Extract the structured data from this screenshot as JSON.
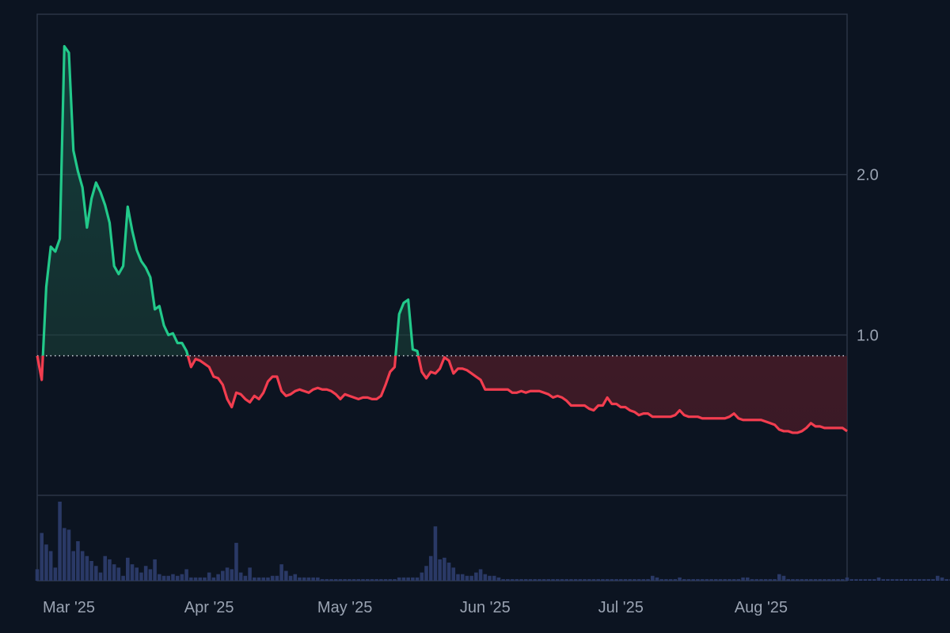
{
  "chart_data": {
    "type": "area",
    "title": "",
    "xlabel": "",
    "ylabel": "",
    "baseline": 0.87,
    "xlim": [
      "2025-02-22",
      "2025-08-20"
    ],
    "ylim": [
      0.0,
      3.0
    ],
    "y_ticks": [
      1.0,
      2.0
    ],
    "y_tick_labels": [
      "1.0",
      "2.0"
    ],
    "x_ticks": [
      "2025-03-01",
      "2025-04-01",
      "2025-05-01",
      "2025-06-01",
      "2025-07-01",
      "2025-08-01"
    ],
    "x_tick_labels": [
      "Mar '25",
      "Apr '25",
      "May '25",
      "Jun '25",
      "Jul '25",
      "Aug '25"
    ],
    "grid": true,
    "legend": "none",
    "colors": {
      "background": "#0c1421",
      "above_baseline": "#22c98a",
      "below_baseline": "#f23d4f",
      "volume": "#2a3966",
      "grid": "#2b3546",
      "baseline": "#d0d6e0"
    },
    "series": [
      {
        "x": [
          "2025-02-22",
          "2025-02-23",
          "2025-02-24",
          "2025-02-25",
          "2025-02-26",
          "2025-02-27",
          "2025-02-28",
          "2025-03-01",
          "2025-03-02",
          "2025-03-03",
          "2025-03-04",
          "2025-03-05",
          "2025-03-06",
          "2025-03-07",
          "2025-03-08",
          "2025-03-09",
          "2025-03-10",
          "2025-03-11",
          "2025-03-12",
          "2025-03-13",
          "2025-03-14",
          "2025-03-15",
          "2025-03-16",
          "2025-03-17",
          "2025-03-18",
          "2025-03-19",
          "2025-03-20",
          "2025-03-21",
          "2025-03-22",
          "2025-03-23",
          "2025-03-24",
          "2025-03-25",
          "2025-03-26",
          "2025-03-27",
          "2025-03-28",
          "2025-03-29",
          "2025-03-30",
          "2025-03-31",
          "2025-04-01",
          "2025-04-02",
          "2025-04-03",
          "2025-04-04",
          "2025-04-05",
          "2025-04-06",
          "2025-04-07",
          "2025-04-08",
          "2025-04-09",
          "2025-04-10",
          "2025-04-11",
          "2025-04-12",
          "2025-04-13",
          "2025-04-14",
          "2025-04-15",
          "2025-04-16",
          "2025-04-17",
          "2025-04-18",
          "2025-04-19",
          "2025-04-20",
          "2025-04-21",
          "2025-04-22",
          "2025-04-23",
          "2025-04-24",
          "2025-04-25",
          "2025-04-26",
          "2025-04-27",
          "2025-04-28",
          "2025-04-29",
          "2025-04-30",
          "2025-05-01",
          "2025-05-02",
          "2025-05-03",
          "2025-05-04",
          "2025-05-05",
          "2025-05-06",
          "2025-05-07",
          "2025-05-08",
          "2025-05-09",
          "2025-05-10",
          "2025-05-11",
          "2025-05-12",
          "2025-05-13",
          "2025-05-14",
          "2025-05-15",
          "2025-05-16",
          "2025-05-17",
          "2025-05-18",
          "2025-05-19",
          "2025-05-20",
          "2025-05-21",
          "2025-05-22",
          "2025-05-23",
          "2025-05-24",
          "2025-05-25",
          "2025-05-26",
          "2025-05-27",
          "2025-05-28",
          "2025-05-29",
          "2025-05-30",
          "2025-05-31",
          "2025-06-01",
          "2025-06-02",
          "2025-06-03",
          "2025-06-04",
          "2025-06-05",
          "2025-06-06",
          "2025-06-07",
          "2025-06-08",
          "2025-06-09",
          "2025-06-10",
          "2025-06-11",
          "2025-06-12",
          "2025-06-13",
          "2025-06-14",
          "2025-06-15",
          "2025-06-16",
          "2025-06-17",
          "2025-06-18",
          "2025-06-19",
          "2025-06-20",
          "2025-06-21",
          "2025-06-22",
          "2025-06-23",
          "2025-06-24",
          "2025-06-25",
          "2025-06-26",
          "2025-06-27",
          "2025-06-28",
          "2025-06-29",
          "2025-06-30",
          "2025-07-01",
          "2025-07-02",
          "2025-07-03",
          "2025-07-04",
          "2025-07-05",
          "2025-07-06",
          "2025-07-07",
          "2025-07-08",
          "2025-07-09",
          "2025-07-10",
          "2025-07-11",
          "2025-07-12",
          "2025-07-13",
          "2025-07-14",
          "2025-07-15",
          "2025-07-16",
          "2025-07-17",
          "2025-07-18",
          "2025-07-19",
          "2025-07-20",
          "2025-07-21",
          "2025-07-22",
          "2025-07-23",
          "2025-07-24",
          "2025-07-25",
          "2025-07-26",
          "2025-07-27",
          "2025-07-28",
          "2025-07-29",
          "2025-07-30",
          "2025-07-31",
          "2025-08-01",
          "2025-08-02",
          "2025-08-03",
          "2025-08-04",
          "2025-08-05",
          "2025-08-06",
          "2025-08-07",
          "2025-08-08",
          "2025-08-09",
          "2025-08-10",
          "2025-08-11",
          "2025-08-12",
          "2025-08-13",
          "2025-08-14",
          "2025-08-15",
          "2025-08-16",
          "2025-08-17",
          "2025-08-18",
          "2025-08-19",
          "2025-08-20"
        ],
        "values": [
          0.87,
          0.72,
          1.3,
          1.55,
          1.52,
          1.6,
          2.8,
          2.76,
          2.15,
          2.02,
          1.92,
          1.67,
          1.85,
          1.95,
          1.89,
          1.81,
          1.7,
          1.43,
          1.38,
          1.43,
          1.8,
          1.65,
          1.53,
          1.46,
          1.42,
          1.36,
          1.16,
          1.18,
          1.06,
          1.0,
          1.01,
          0.95,
          0.95,
          0.9,
          0.8,
          0.85,
          0.84,
          0.82,
          0.8,
          0.74,
          0.73,
          0.69,
          0.6,
          0.55,
          0.64,
          0.63,
          0.6,
          0.58,
          0.62,
          0.6,
          0.64,
          0.71,
          0.74,
          0.74,
          0.65,
          0.62,
          0.63,
          0.65,
          0.66,
          0.65,
          0.64,
          0.66,
          0.67,
          0.66,
          0.66,
          0.65,
          0.63,
          0.6,
          0.63,
          0.62,
          0.61,
          0.6,
          0.61,
          0.61,
          0.6,
          0.6,
          0.62,
          0.69,
          0.77,
          0.8,
          1.13,
          1.2,
          1.22,
          0.91,
          0.9,
          0.77,
          0.73,
          0.77,
          0.76,
          0.79,
          0.86,
          0.84,
          0.76,
          0.79,
          0.79,
          0.78,
          0.76,
          0.74,
          0.72,
          0.66,
          0.66,
          0.66,
          0.66,
          0.66,
          0.66,
          0.64,
          0.64,
          0.65,
          0.64,
          0.65,
          0.65,
          0.65,
          0.64,
          0.63,
          0.61,
          0.62,
          0.61,
          0.59,
          0.56,
          0.56,
          0.56,
          0.56,
          0.54,
          0.53,
          0.56,
          0.56,
          0.61,
          0.57,
          0.57,
          0.55,
          0.55,
          0.53,
          0.52,
          0.5,
          0.51,
          0.51,
          0.49,
          0.49,
          0.49,
          0.49,
          0.49,
          0.5,
          0.53,
          0.5,
          0.49,
          0.49,
          0.49,
          0.48,
          0.48,
          0.48,
          0.48,
          0.48,
          0.48,
          0.49,
          0.51,
          0.48,
          0.47,
          0.47,
          0.47,
          0.47,
          0.47,
          0.46,
          0.45,
          0.44,
          0.41,
          0.4,
          0.4,
          0.39,
          0.39,
          0.4,
          0.42,
          0.45,
          0.43,
          0.43,
          0.42,
          0.42,
          0.42,
          0.42,
          0.42,
          0.4
        ]
      }
    ],
    "volume": {
      "x_start": "2025-02-22",
      "values": [
        7,
        29,
        22,
        18,
        8,
        48,
        32,
        31,
        18,
        24,
        18,
        15,
        12,
        9,
        5,
        15,
        13,
        10,
        8,
        3,
        14,
        10,
        8,
        5,
        9,
        7,
        13,
        4,
        3,
        3,
        4,
        3,
        4,
        7,
        2,
        2,
        2,
        2,
        5,
        2,
        4,
        6,
        8,
        7,
        23,
        5,
        3,
        8,
        2,
        2,
        2,
        2,
        3,
        3,
        10,
        6,
        3,
        4,
        2,
        2,
        2,
        2,
        2,
        1,
        1,
        1,
        1,
        1,
        1,
        1,
        1,
        1,
        1,
        1,
        1,
        1,
        1,
        1,
        1,
        1,
        2,
        2,
        2,
        2,
        2,
        5,
        9,
        15,
        33,
        13,
        14,
        11,
        8,
        4,
        4,
        3,
        3,
        5,
        7,
        4,
        3,
        3,
        2,
        1,
        1,
        1,
        1,
        1,
        1,
        1,
        1,
        1,
        1,
        1,
        1,
        1,
        1,
        1,
        1,
        1,
        1,
        1,
        1,
        1,
        1,
        1,
        1,
        1,
        1,
        1,
        1,
        1,
        1,
        1,
        1,
        1,
        3,
        2,
        1,
        1,
        1,
        1,
        2,
        1,
        1,
        1,
        1,
        1,
        1,
        1,
        1,
        1,
        1,
        1,
        1,
        1,
        2,
        2,
        1,
        1,
        1,
        1,
        1,
        1,
        4,
        3,
        1,
        1,
        1,
        1,
        1,
        1,
        1,
        1,
        1,
        1,
        1,
        1,
        1,
        2,
        1,
        1,
        1,
        1,
        1,
        1,
        2,
        1,
        1,
        1,
        1,
        1,
        1,
        1,
        1,
        1,
        1,
        1,
        1,
        3,
        2,
        1,
        1,
        1,
        1
      ]
    }
  }
}
